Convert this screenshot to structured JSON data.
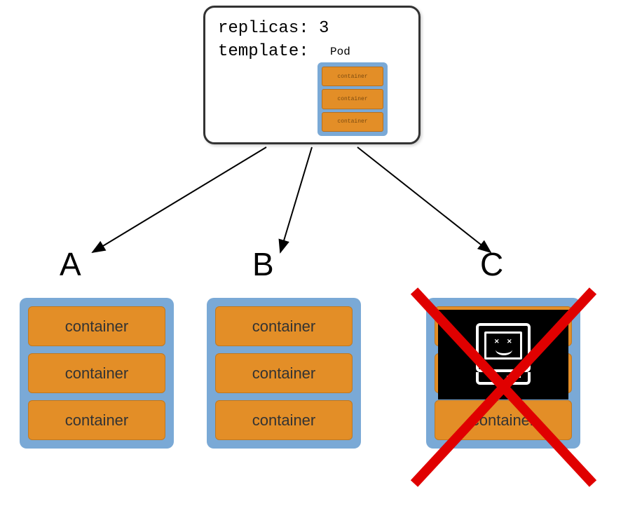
{
  "spec": {
    "replicas_label": "replicas: 3",
    "template_label": "template:",
    "pod_label": "Pod",
    "mini_containers": [
      "container",
      "container",
      "container"
    ]
  },
  "pods": [
    {
      "label": "A",
      "containers": [
        "container",
        "container",
        "container"
      ],
      "failed": false
    },
    {
      "label": "B",
      "containers": [
        "container",
        "container",
        "container"
      ],
      "failed": false
    },
    {
      "label": "C",
      "containers": [
        "container",
        "container",
        "container"
      ],
      "failed": true
    }
  ],
  "colors": {
    "pod_bg": "#7aa9d6",
    "container_bg": "#e38e27",
    "cross": "#e00000"
  }
}
